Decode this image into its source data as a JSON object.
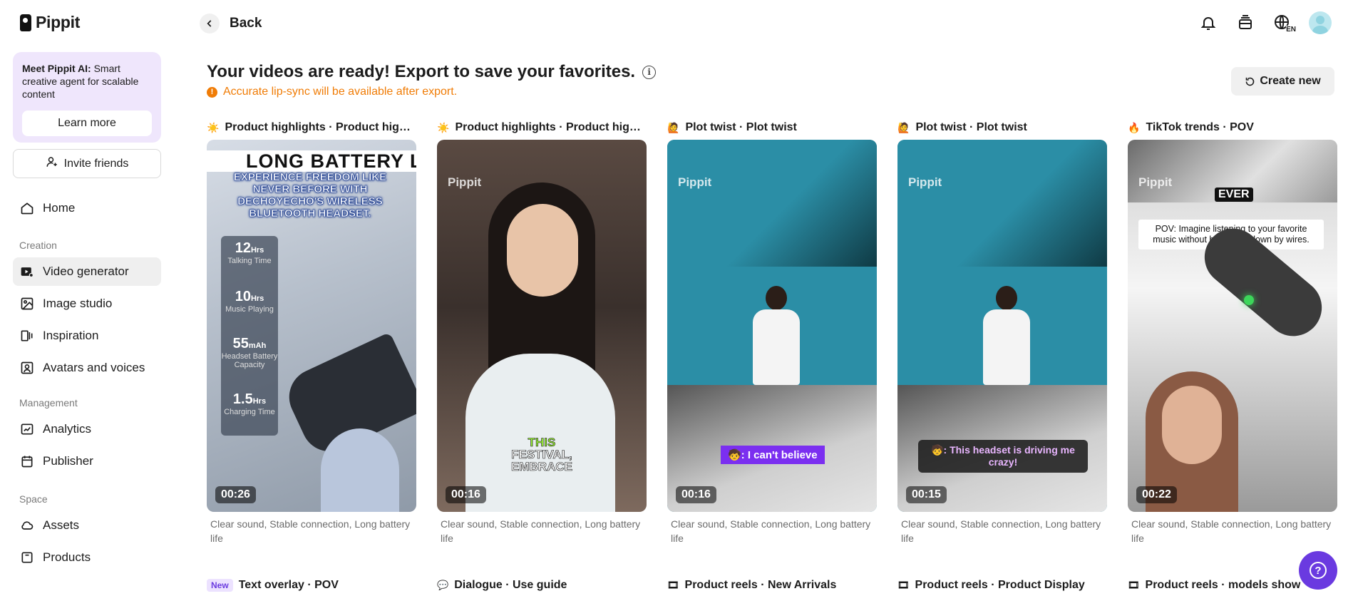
{
  "app": {
    "name": "Pippit"
  },
  "promo": {
    "title": "Meet Pippit AI:",
    "text": " Smart creative agent for scalable content",
    "button": "Learn more"
  },
  "invite": {
    "label": "Invite friends"
  },
  "nav": {
    "home": "Home",
    "creation_section": "Creation",
    "video_generator": "Video generator",
    "image_studio": "Image studio",
    "inspiration": "Inspiration",
    "avatars_voices": "Avatars and voices",
    "management_section": "Management",
    "analytics": "Analytics",
    "publisher": "Publisher",
    "space_section": "Space",
    "assets": "Assets",
    "products": "Products"
  },
  "header": {
    "back": "Back",
    "lang": "EN"
  },
  "main": {
    "headline": "Your videos are ready! Export to save your favorites.",
    "warning": "Accurate lip-sync will be available after export.",
    "create_new": "Create new"
  },
  "cards": [
    {
      "emoji": "☀️",
      "title": "Product highlights · Product highli…",
      "duration": "00:26",
      "desc": "Clear sound, Stable connection, Long battery life",
      "overlay_top": "LONG BATTERY LI",
      "overlay_caption": "EXPERIENCE FREEDOM LIKE NEVER BEFORE WITH DECHOYECHO'S WIRELESS BLUETOOTH HEADSET.",
      "stats": [
        {
          "v": "12",
          "u": "Hrs",
          "l": "Talking Time"
        },
        {
          "v": "10",
          "u": "Hrs",
          "l": "Music Playing"
        },
        {
          "v": "55",
          "u": "mAh",
          "l": "Headset Battery Capacity"
        },
        {
          "v": "1.5",
          "u": "Hrs",
          "l": "Charging Time"
        }
      ]
    },
    {
      "emoji": "☀️",
      "title": "Product highlights · Product highli…",
      "duration": "00:16",
      "desc": "Clear sound, Stable connection, Long battery life",
      "brand": "Pippit",
      "subtitle_1": "THIS",
      "subtitle_2": "FESTIVAL,",
      "subtitle_3": "EMBRACE"
    },
    {
      "emoji": "🙋",
      "title": "Plot twist · Plot twist",
      "duration": "00:16",
      "desc": "Clear sound, Stable connection, Long battery life",
      "brand": "Pippit",
      "caption": "🧒: I can't believe"
    },
    {
      "emoji": "🙋",
      "title": "Plot twist · Plot twist",
      "duration": "00:15",
      "desc": "Clear sound, Stable connection, Long battery life",
      "brand": "Pippit",
      "caption": "🧒: This headset is driving me crazy!"
    },
    {
      "emoji": "🔥",
      "title": "TikTok trends · POV",
      "duration": "00:22",
      "desc": "Clear sound, Stable connection, Long battery life",
      "brand": "Pippit",
      "top_word": "EVER",
      "caption": "POV: Imagine listening to your favorite music without being tied down by wires."
    }
  ],
  "row2": [
    {
      "badge": "New",
      "label": "Text overlay · POV"
    },
    {
      "emoji": "💬",
      "label": "Dialogue · Use guide"
    },
    {
      "emoji": "🎞",
      "label": "Product reels · New Arrivals"
    },
    {
      "emoji": "🎞",
      "label": "Product reels · Product Display"
    },
    {
      "emoji": "🎞",
      "label": "Product reels · models show"
    }
  ]
}
